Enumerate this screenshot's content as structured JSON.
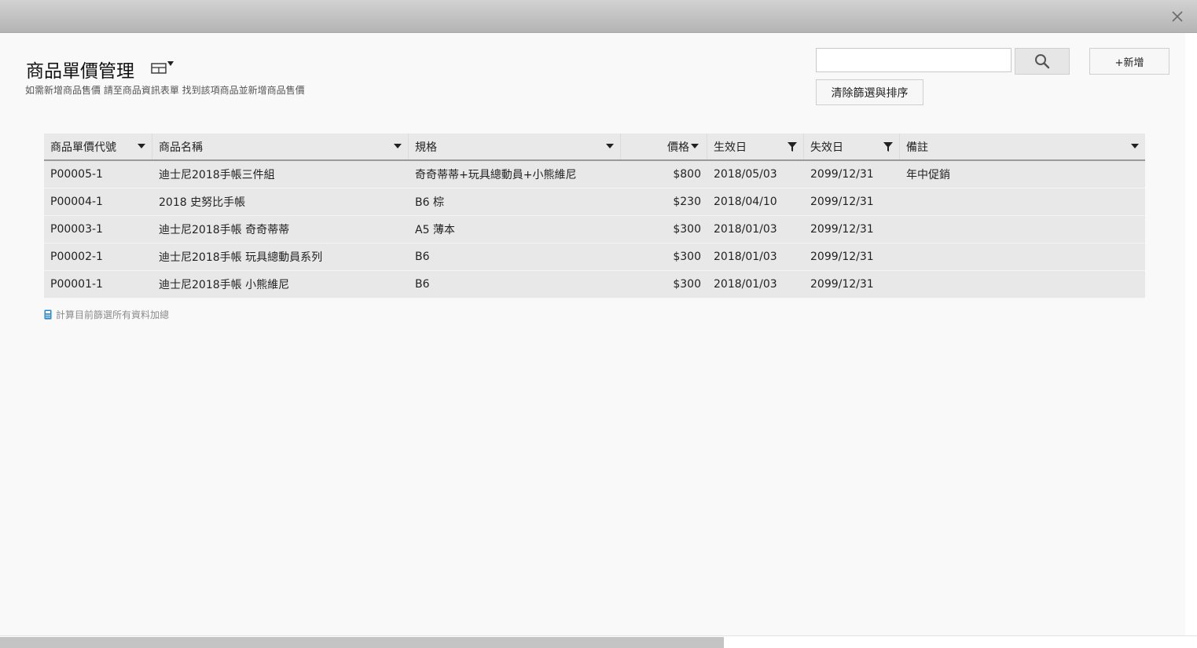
{
  "page": {
    "title": "商品單價管理",
    "subtitle": "如需新增商品售價 請至商品資訊表單 找到該項商品並新增商品售價"
  },
  "toolbar": {
    "search_value": "",
    "search_icon": "search-icon",
    "add_label": "+新增",
    "clear_label": "清除篩選與排序"
  },
  "grid": {
    "columns": [
      {
        "key": "code",
        "label": "商品單價代號",
        "icon": "sort-caret-icon"
      },
      {
        "key": "name",
        "label": "商品名稱",
        "icon": "sort-caret-icon"
      },
      {
        "key": "spec",
        "label": "規格",
        "icon": "sort-caret-icon"
      },
      {
        "key": "price",
        "label": "價格",
        "icon": "sort-caret-icon"
      },
      {
        "key": "start",
        "label": "生效日",
        "icon": "filter-icon"
      },
      {
        "key": "end",
        "label": "失效日",
        "icon": "filter-icon"
      },
      {
        "key": "note",
        "label": "備註",
        "icon": "sort-caret-icon"
      }
    ],
    "rows": [
      {
        "code": "P00005-1",
        "name": "迪士尼2018手帳三件組",
        "spec": "奇奇蒂蒂+玩具總動員+小熊維尼",
        "price": "$800",
        "start": "2018/05/03",
        "end": "2099/12/31",
        "note": "年中促銷"
      },
      {
        "code": "P00004-1",
        "name": "2018 史努比手帳",
        "spec": "B6 棕",
        "price": "$230",
        "start": "2018/04/10",
        "end": "2099/12/31",
        "note": ""
      },
      {
        "code": "P00003-1",
        "name": "迪士尼2018手帳 奇奇蒂蒂",
        "spec": "A5 薄本",
        "price": "$300",
        "start": "2018/01/03",
        "end": "2099/12/31",
        "note": ""
      },
      {
        "code": "P00002-1",
        "name": "迪士尼2018手帳 玩具總動員系列",
        "spec": "B6",
        "price": "$300",
        "start": "2018/01/03",
        "end": "2099/12/31",
        "note": ""
      },
      {
        "code": "P00001-1",
        "name": "迪士尼2018手帳 小熊維尼",
        "spec": "B6",
        "price": "$300",
        "start": "2018/01/03",
        "end": "2099/12/31",
        "note": ""
      }
    ]
  },
  "footer": {
    "sum_label": "計算目前篩選所有資料加總",
    "sum_icon": "calculator-icon"
  },
  "colors": {
    "titlebar": "#bdbdbd",
    "header_bg": "#e9e9e9",
    "row_bg": "#e8e8e8",
    "calculator_icon": "#2a86c7"
  },
  "window": {
    "close_icon": "close-icon",
    "view_toggle_icon": "table-view-icon"
  }
}
